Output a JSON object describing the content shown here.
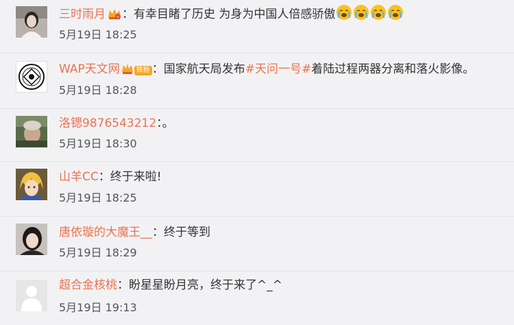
{
  "comments": [
    {
      "username": "三时雨月",
      "colon": "：",
      "text": "有幸目睹了历史 为身为中国人倍感骄傲",
      "emojis": [
        "crying-emoji",
        "crying-emoji",
        "crying-emoji",
        "crying-emoji"
      ],
      "time": "5月19日 18:25"
    },
    {
      "username": "WAP天文网",
      "badge": "铁粉",
      "colon": "：",
      "text_before": "国家航天局发布",
      "topic": "#天问一号#",
      "text_after": "着陆过程两器分离和落火影像。",
      "time": "5月19日 18:28"
    },
    {
      "username": "洛锶9876543212",
      "colon": "：",
      "text": "。",
      "time": "5月19日 18:30"
    },
    {
      "username": "山羊CC",
      "colon": "：",
      "text": "终于来啦!",
      "time": "5月19日 18:25"
    },
    {
      "username": "唐依璇的大魔王__",
      "colon": "：",
      "text": "终于等到",
      "time": "5月19日 18:29"
    },
    {
      "username": "超合金核桃",
      "colon": "：",
      "text": "盼星星盼月亮，终于来了^_^",
      "time": "5月19日 19:13"
    }
  ],
  "colors": {
    "username": "#eb7350",
    "text": "#333333",
    "time": "#555555",
    "background": "#f2f2f5",
    "badge": "#f6a623"
  }
}
